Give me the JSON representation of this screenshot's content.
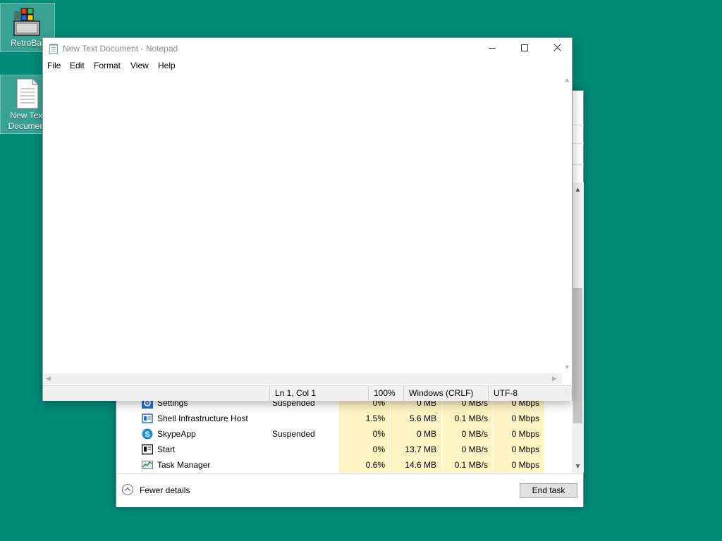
{
  "desktop": {
    "background": "#018a78",
    "icons": [
      {
        "label": "RetroBar",
        "icon": "retrobar-icon"
      },
      {
        "label": "New Text Document",
        "icon": "text-document-icon"
      }
    ]
  },
  "notepad": {
    "title": "New Text Document - Notepad",
    "menu": [
      "File",
      "Edit",
      "Format",
      "View",
      "Help"
    ],
    "content": "",
    "status": {
      "position": "Ln 1, Col 1",
      "zoom": "100%",
      "line_ending": "Windows (CRLF)",
      "encoding": "UTF-8"
    }
  },
  "task_manager": {
    "processes": [
      {
        "name": "Settings",
        "status": "Suspended",
        "cpu": "0%",
        "memory": "0 MB",
        "disk": "0 MB/s",
        "network": "0 Mbps",
        "icon": "settings-gear-icon"
      },
      {
        "name": "Shell Infrastructure Host",
        "status": "",
        "cpu": "1.5%",
        "memory": "5.6 MB",
        "disk": "0.1 MB/s",
        "network": "0 Mbps",
        "icon": "shell-host-icon"
      },
      {
        "name": "SkypeApp",
        "status": "Suspended",
        "cpu": "0%",
        "memory": "0 MB",
        "disk": "0 MB/s",
        "network": "0 Mbps",
        "icon": "skype-icon"
      },
      {
        "name": "Start",
        "status": "",
        "cpu": "0%",
        "memory": "13.7 MB",
        "disk": "0 MB/s",
        "network": "0 Mbps",
        "icon": "start-icon"
      },
      {
        "name": "Task Manager",
        "status": "",
        "cpu": "0.6%",
        "memory": "14.6 MB",
        "disk": "0.1 MB/s",
        "network": "0 Mbps",
        "icon": "task-manager-icon"
      }
    ],
    "fewer_details": "Fewer details",
    "end_task": "End task",
    "highlight_color": "#fff4c4"
  }
}
